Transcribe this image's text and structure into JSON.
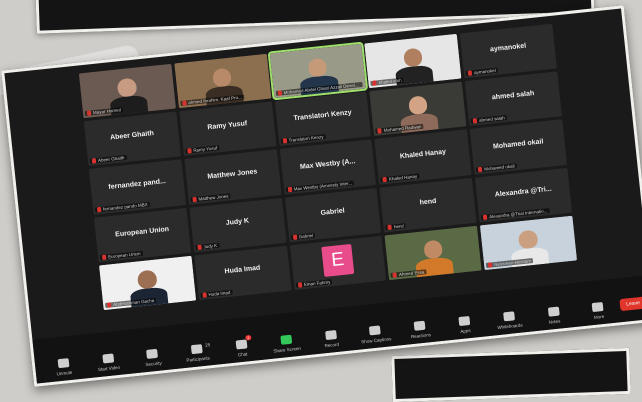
{
  "app": "Zoom Meeting",
  "tiles": [
    {
      "name": "",
      "caption": "Mayar Hamed",
      "video": "woman"
    },
    {
      "name": "",
      "caption": "ahmed Ibrahim, Kaaf Pro...",
      "video": "room"
    },
    {
      "name": "",
      "caption": "Mohamed Abdel Ghani Azzali Development ...",
      "video": "man",
      "active": true
    },
    {
      "name": "",
      "caption": "khaled elnh",
      "video": "sunglasses"
    },
    {
      "name": "aymanokel",
      "caption": "aymanokel"
    },
    {
      "name": "Abeer Ghaith",
      "caption": "Abeer Ghaith"
    },
    {
      "name": "Ramy Yusuf",
      "caption": "Ramy Yusuf"
    },
    {
      "name": "Translator\\ Kenzy",
      "caption": "Translator\\ Kenzy"
    },
    {
      "name": "",
      "caption": "Mohamed Radwan",
      "video": "standing"
    },
    {
      "name": "ahmed salah",
      "caption": "ahmed salah"
    },
    {
      "name": "fernandez pand...",
      "caption": "fernandez pando MBX"
    },
    {
      "name": "Matthew Jones",
      "caption": "Matthew Jones"
    },
    {
      "name": "Max Westby (A...",
      "caption": "Max Westby (Amnesty Inter..."
    },
    {
      "name": "Khaled Hanay",
      "caption": "Khaled Hanay"
    },
    {
      "name": "Mohamed okail",
      "caption": "Mohamed okail"
    },
    {
      "name": "European Union",
      "caption": "European Union"
    },
    {
      "name": "Judy K",
      "caption": "Judy K"
    },
    {
      "name": "Gabriel",
      "caption": "Gabriel"
    },
    {
      "name": "hend",
      "caption": "hend"
    },
    {
      "name": "Alexandra @Tri...",
      "caption": "Alexandra @Trial Internatio..."
    },
    {
      "name": "",
      "caption": "Abdelrahman Gacha",
      "video": "suit"
    },
    {
      "name": "Huda Imad",
      "caption": "Huda Imad"
    },
    {
      "name": "",
      "caption": "Eman Fahmy",
      "letter": "E"
    },
    {
      "name": "",
      "caption": "Ahmed Essa",
      "video": "outdoor"
    },
    {
      "name": "",
      "caption": "Nessreen Hossam",
      "video": "window"
    }
  ],
  "toolbar": {
    "items": [
      {
        "label": "Unmute",
        "icon": "microphone-icon"
      },
      {
        "label": "Start Video",
        "icon": "video-camera-icon"
      },
      {
        "label": "Security",
        "icon": "shield-icon"
      },
      {
        "label": "Participants",
        "icon": "people-icon",
        "count": "25"
      },
      {
        "label": "Chat",
        "icon": "chat-icon",
        "badge": "2"
      },
      {
        "label": "Share Screen",
        "icon": "share-screen-icon",
        "accent": true
      },
      {
        "label": "Record",
        "icon": "record-icon"
      },
      {
        "label": "Show Captions",
        "icon": "cc-icon"
      },
      {
        "label": "Reactions",
        "icon": "smile-icon"
      },
      {
        "label": "Apps",
        "icon": "apps-icon"
      },
      {
        "label": "Whiteboards",
        "icon": "whiteboard-icon"
      },
      {
        "label": "Notes",
        "icon": "notes-icon"
      },
      {
        "label": "More",
        "icon": "more-icon"
      }
    ],
    "leave_label": "Leave"
  },
  "colors": {
    "leave": "#e0352b",
    "accent_green": "#34c759",
    "mic_muted": "#d8322f",
    "avatar_pink": "#e84c8a"
  }
}
